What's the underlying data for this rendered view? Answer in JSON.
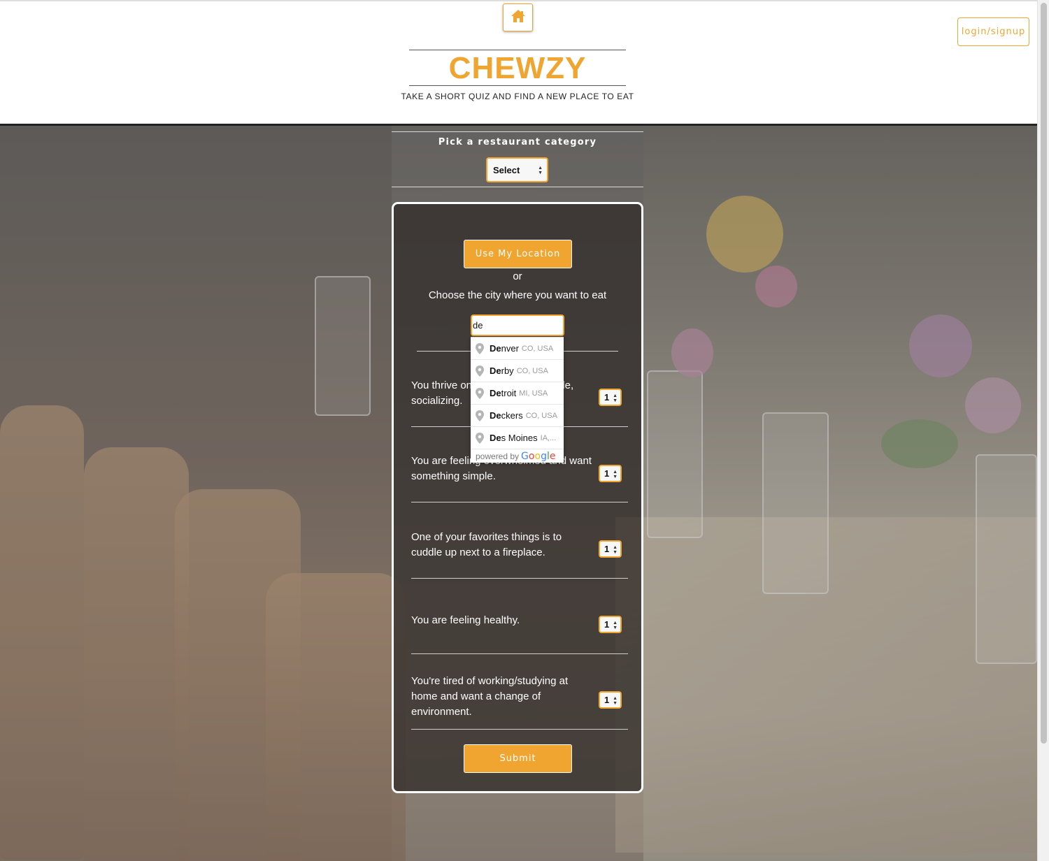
{
  "header": {
    "title": "CHEWZY",
    "subtitle": "TAKE A SHORT QUIZ AND FIND A NEW PLACE TO EAT",
    "login_label": "login/signup",
    "home_icon": "home-icon"
  },
  "category": {
    "label": "Pick a restaurant category",
    "selected": "Select"
  },
  "location": {
    "use_location_label": "Use My Location",
    "or_text": "or",
    "city_prompt": "Choose the city where you want to eat",
    "city_input_value": "de"
  },
  "autocomplete": {
    "items": [
      {
        "match": "De",
        "rest": "nver",
        "secondary": "CO, USA"
      },
      {
        "match": "De",
        "rest": "rby",
        "secondary": "CO, USA"
      },
      {
        "match": "De",
        "rest": "troit",
        "secondary": "MI, USA"
      },
      {
        "match": "De",
        "rest": "ckers",
        "secondary": "CO, USA"
      },
      {
        "match": "De",
        "rest": "s Moines",
        "secondary": "IA,..."
      }
    ],
    "powered_by": "powered by",
    "google": [
      "G",
      "o",
      "o",
      "g",
      "l",
      "e"
    ]
  },
  "questions": [
    {
      "text": "You thrive on being around people, socializing.",
      "value": "1"
    },
    {
      "text": "You are feeling overwhelmed and want something simple.",
      "value": "1"
    },
    {
      "text": "One of your favorites things is to cuddle up next to a fireplace.",
      "value": "1"
    },
    {
      "text": "You are feeling healthy.",
      "value": "1"
    },
    {
      "text": "You're tired of working/studying at home and want a change of environment.",
      "value": "1"
    }
  ],
  "submit_label": "Submit",
  "colors": {
    "accent": "#f0a531",
    "panel": "#322d2a"
  }
}
